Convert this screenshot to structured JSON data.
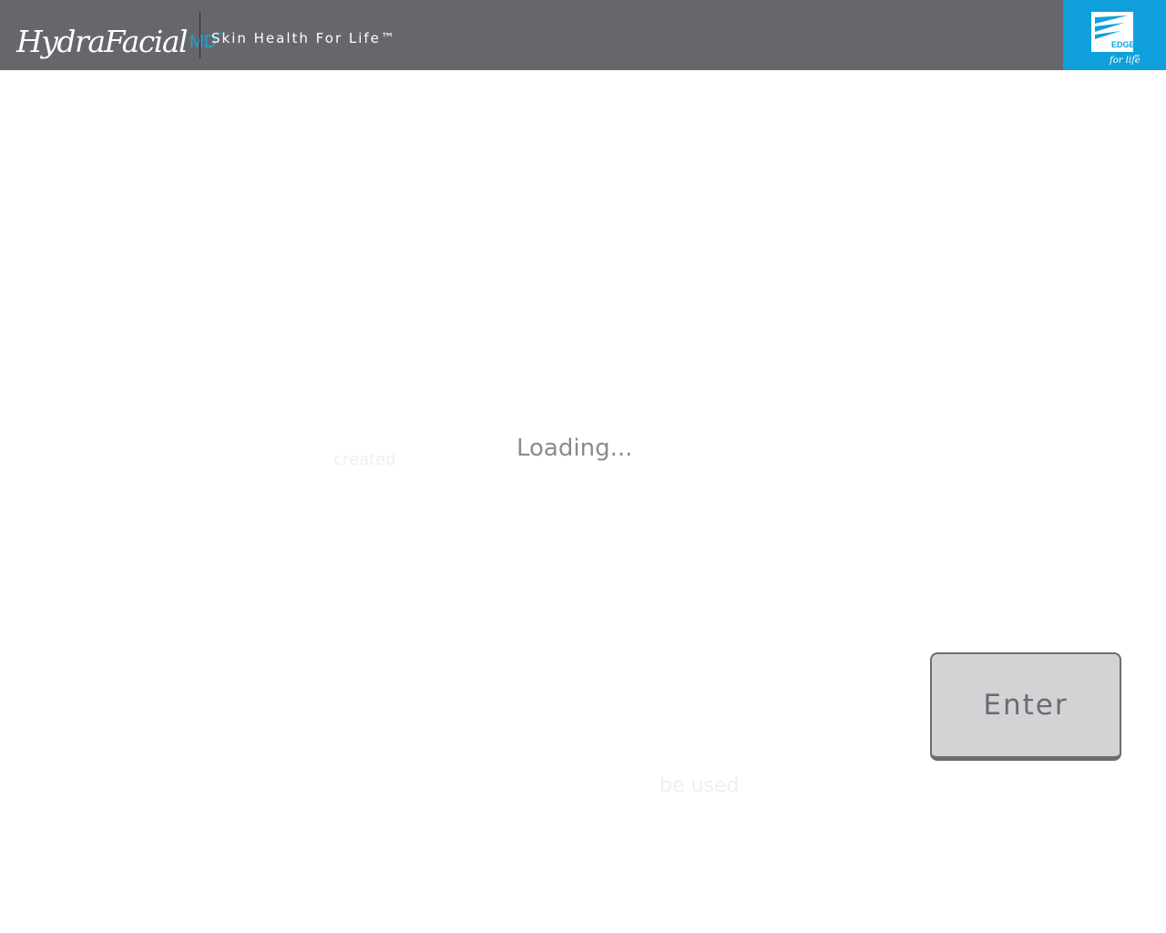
{
  "header": {
    "logo_script": "HydraFacial",
    "logo_md": "MD",
    "logo_reg": "®",
    "tagline": "Skin Health For Life™",
    "edge_logo": {
      "icon": "edge-for-life-logo",
      "line1": "EDGE",
      "line2": "for life",
      "tm": "™"
    }
  },
  "background_ghost_text": [
    "created",
    "be used"
  ],
  "main": {
    "loading_text": "Loading..."
  },
  "actions": {
    "enter_label": "Enter"
  },
  "colors": {
    "header_bg": "#66676b",
    "accent_blue": "#0fa0dc",
    "button_bg": "#d2d3d5",
    "button_text": "#6b6c70",
    "loading_text": "#8a8b8e"
  }
}
